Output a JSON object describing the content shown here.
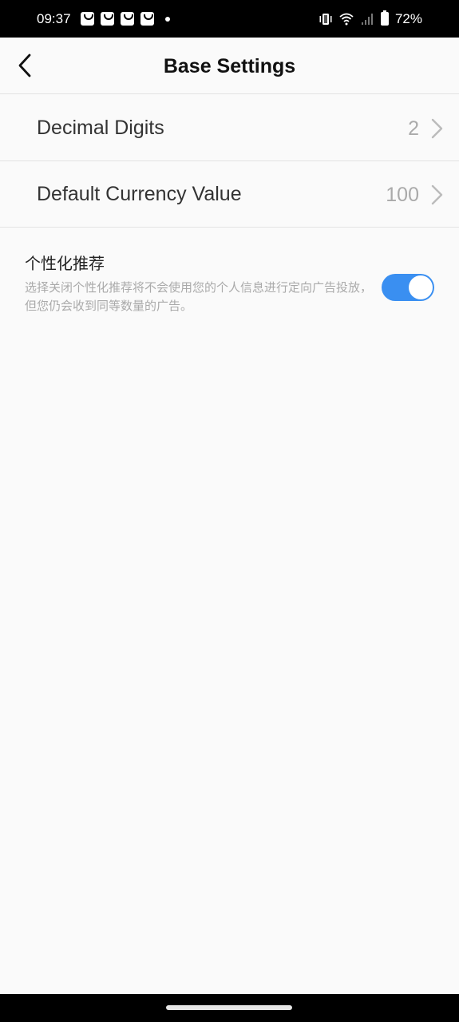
{
  "status_bar": {
    "time": "09:37",
    "notification_icons": [
      "shopping-bag-icon",
      "shopping-bag-icon",
      "shopping-bag-icon",
      "shopping-bag-icon"
    ],
    "battery_percent": "72%",
    "system_icons": [
      "vibrate-icon",
      "wifi-icon",
      "signal-icon",
      "battery-charging-icon"
    ]
  },
  "header": {
    "title": "Base Settings",
    "back_icon": "chevron-left-icon"
  },
  "settings": [
    {
      "label": "Decimal Digits",
      "value": "2"
    },
    {
      "label": "Default Currency Value",
      "value": "100"
    }
  ],
  "personalization": {
    "title": "个性化推荐",
    "description": "选择关闭个性化推荐将不会使用您的个人信息进行定向广告投放，但您仍会收到同等数量的广告。",
    "enabled": true,
    "toggle_color": "#3a8ff1"
  }
}
